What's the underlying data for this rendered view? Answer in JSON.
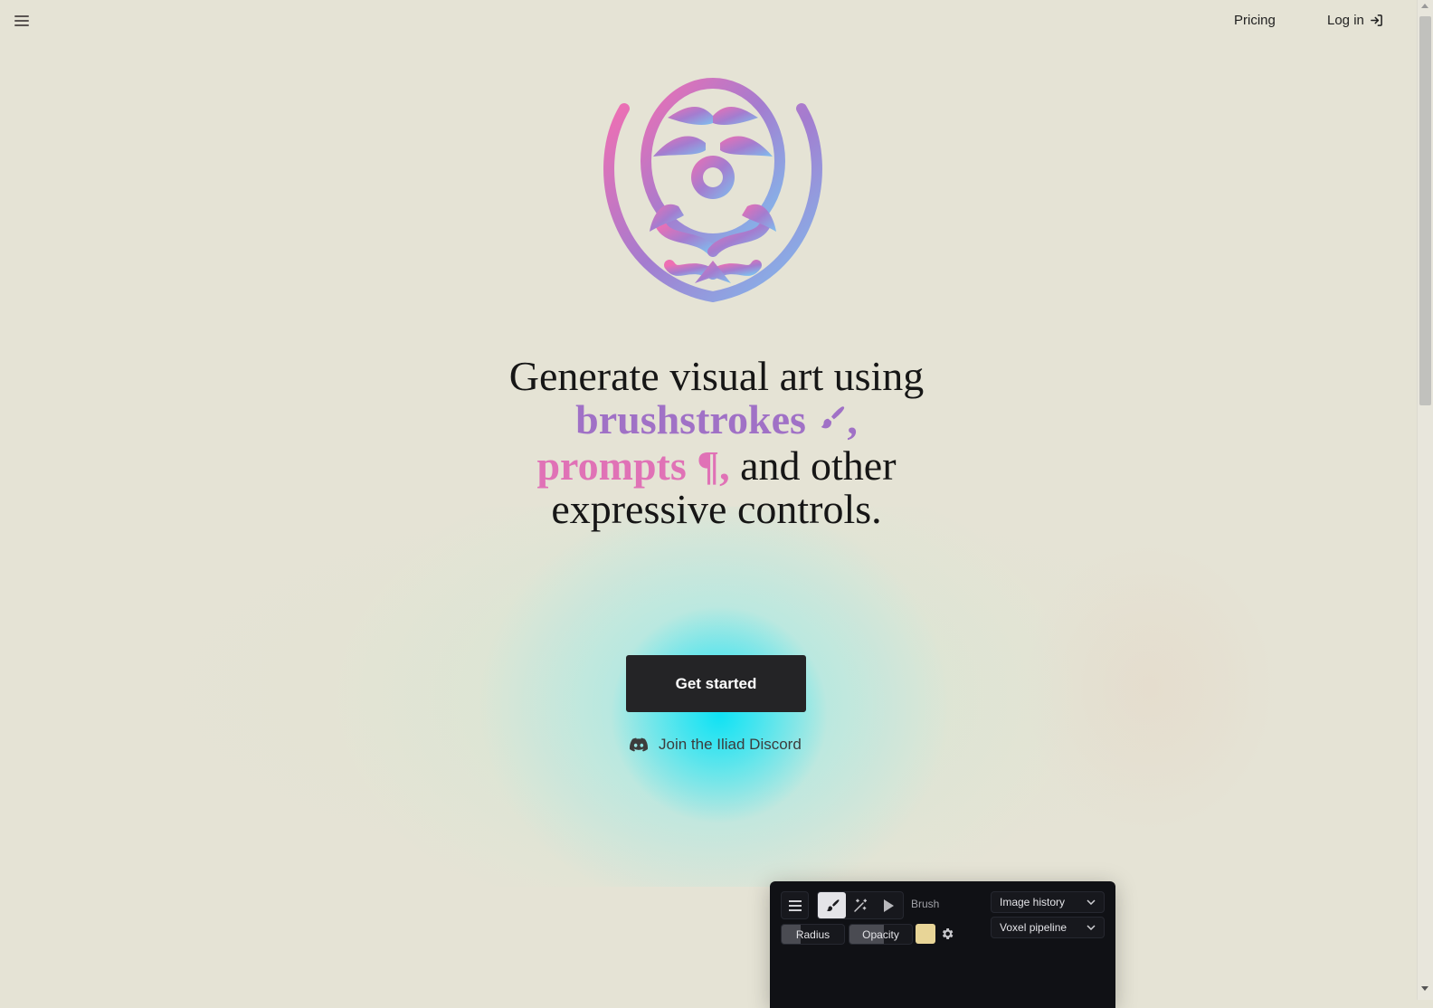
{
  "topbar": {
    "menu_icon": "hamburger-menu-icon",
    "nav": {
      "pricing": "Pricing",
      "login": "Log in",
      "login_icon": "sign-in-arrow-icon"
    }
  },
  "hero": {
    "logo": "iliad-floral-logo",
    "headline": {
      "line1": "Generate visual art using",
      "brushstrokes": "brushstrokes",
      "brush_glyph": "🖌",
      "comma1": ",",
      "prompts": "prompts",
      "pilcrow_glyph": "¶,",
      "rest_line3": " and other",
      "line4": "expressive controls."
    },
    "cta_label": "Get started",
    "discord_label": "Join the Iliad Discord",
    "colors": {
      "brushstrokes": "#a071c6",
      "prompts": "#e072b6",
      "cta_bg": "#242426",
      "glow": "#00e1f5"
    }
  },
  "app_preview": {
    "tools": [
      "menu",
      "brush",
      "magic-wand",
      "select"
    ],
    "active_tool": "brush",
    "tool_label": "Brush",
    "sliders": {
      "radius": {
        "label": "Radius",
        "value": 0.3
      },
      "opacity": {
        "label": "Opacity",
        "value": 0.55
      }
    },
    "swatch_color": "#e8d597",
    "dropdowns": {
      "history": "Image history",
      "pipeline": "Voxel pipeline"
    }
  }
}
